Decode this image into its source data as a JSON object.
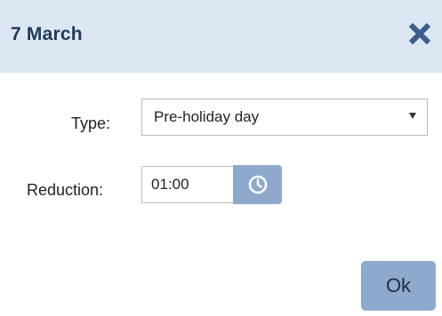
{
  "dialog": {
    "title": "7 March",
    "close_icon": "close-icon"
  },
  "form": {
    "type": {
      "label": "Type:",
      "selected": "Pre-holiday day"
    },
    "reduction": {
      "label": "Reduction:",
      "value": "01:00",
      "picker_icon": "clock-icon"
    }
  },
  "footer": {
    "ok_label": "Ok"
  },
  "colors": {
    "header_bg": "#dce6f2",
    "accent": "#8fa9cc",
    "title_text": "#1f3a56"
  }
}
